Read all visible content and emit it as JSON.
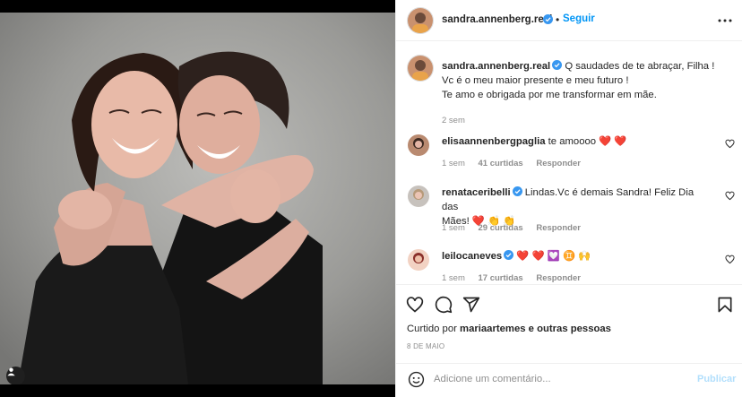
{
  "post": {
    "author": "sandra.annenberg.real",
    "follow_label": "Seguir",
    "separator": "•",
    "photo_alt": "Duas mulheres sorrindo e se abraçando"
  },
  "caption": {
    "author": "sandra.annenberg.real",
    "line1": "Q saudades de te abraçar, Filha !",
    "line2": "Vc é o meu maior presente e meu futuro !",
    "line3": "Te amo e obrigada por me transformar em mãe.",
    "time": "2 sem"
  },
  "comments": [
    {
      "author": "elisaannenbergpaglia",
      "text": "te amoooo ❤️ ❤️",
      "time": "1 sem",
      "likes": "41 curtidas",
      "reply": "Responder"
    },
    {
      "author": "renataceribelli",
      "text_line1": "Lindas.Vc é demais Sandra! Feliz Dia das",
      "text_line2": "Mães! ❤️ 👏 👏",
      "time": "1 sem",
      "likes": "29 curtidas",
      "reply": "Responder"
    },
    {
      "author": "leilocaneves",
      "text": "❤️ ❤️ 💟 ♊ 🙌",
      "time": "1 sem",
      "likes": "17 curtidas",
      "reply": "Responder"
    }
  ],
  "footer": {
    "liked_prefix": "Curtido por",
    "liked_user": "mariaartemes",
    "liked_suffix": "e outras pessoas",
    "date": "8 DE MAIO",
    "comment_placeholder": "Adicione um comentário...",
    "publish_label": "Publicar"
  },
  "colors": {
    "accent": "#0095f6",
    "heart": "#ed4956",
    "verified": "#3897f0",
    "publish_disabled": "#b2dffc"
  }
}
